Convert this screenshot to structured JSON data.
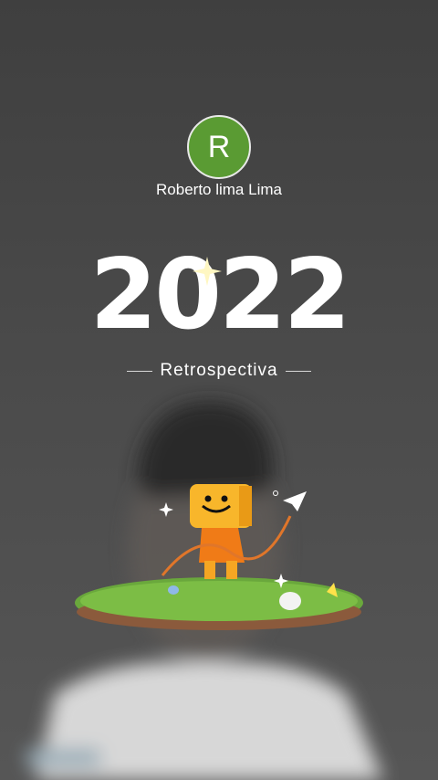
{
  "profile": {
    "avatar_initial": "R",
    "avatar_color": "#5a9b33",
    "name": "Roberto lima Lima"
  },
  "hero": {
    "year": "2022",
    "subtitle": "Retrospectiva"
  },
  "icons": [
    "sparkle-icon",
    "paper-plane-icon",
    "smiley-character-icon"
  ]
}
